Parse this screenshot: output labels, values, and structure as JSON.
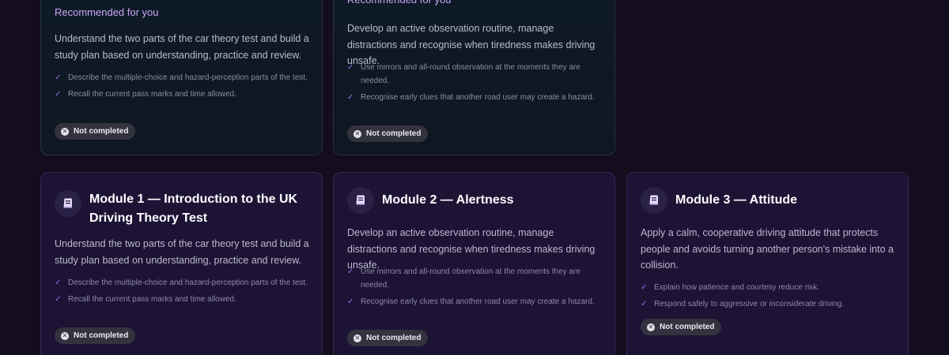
{
  "status_label": "Not completed",
  "recommended_label": "Recommended for you",
  "recommended": [
    {
      "description": "Understand the two parts of the car theory test and build a study plan based on understanding, practice and review.",
      "goals": [
        "Describe the multiple-choice and hazard-perception parts of the test.",
        "Recall the current pass marks and time allowed."
      ]
    },
    {
      "description": "Develop an active observation routine, manage distractions and recognise when tiredness makes driving unsafe.",
      "goals": [
        "Use mirrors and all-round observation at the moments they are needed.",
        "Recognise early clues that another road user may create a hazard."
      ]
    }
  ],
  "modules": [
    {
      "title": "Module 1 — Introduction to the UK Driving Theory Test",
      "description": "Understand the two parts of the car theory test and build a study plan based on understanding, practice and review.",
      "goals": [
        "Describe the multiple-choice and hazard-perception parts of the test.",
        "Recall the current pass marks and time allowed."
      ]
    },
    {
      "title": "Module 2 — Alertness",
      "description": "Develop an active observation routine, manage distractions and recognise when tiredness makes driving unsafe.",
      "goals": [
        "Use mirrors and all-round observation at the moments they are needed.",
        "Recognise early clues that another road user may create a hazard."
      ]
    },
    {
      "title": "Module 3 — Attitude",
      "description": "Apply a calm, cooperative driving attitude that protects people and avoids turning another person's mistake into a collision.",
      "goals": [
        "Explain how patience and courtesy reduce risk.",
        "Respond safely to aggressive or inconsiderate driving."
      ]
    }
  ],
  "icons": {
    "module": "book-icon",
    "check": "check-icon",
    "status": "x-circle-icon"
  },
  "colors": {
    "accent": "#a06ce8",
    "recommended_label": "#c9a7f5",
    "module_card": "#1c1335",
    "recommended_card": "#0f1722"
  }
}
